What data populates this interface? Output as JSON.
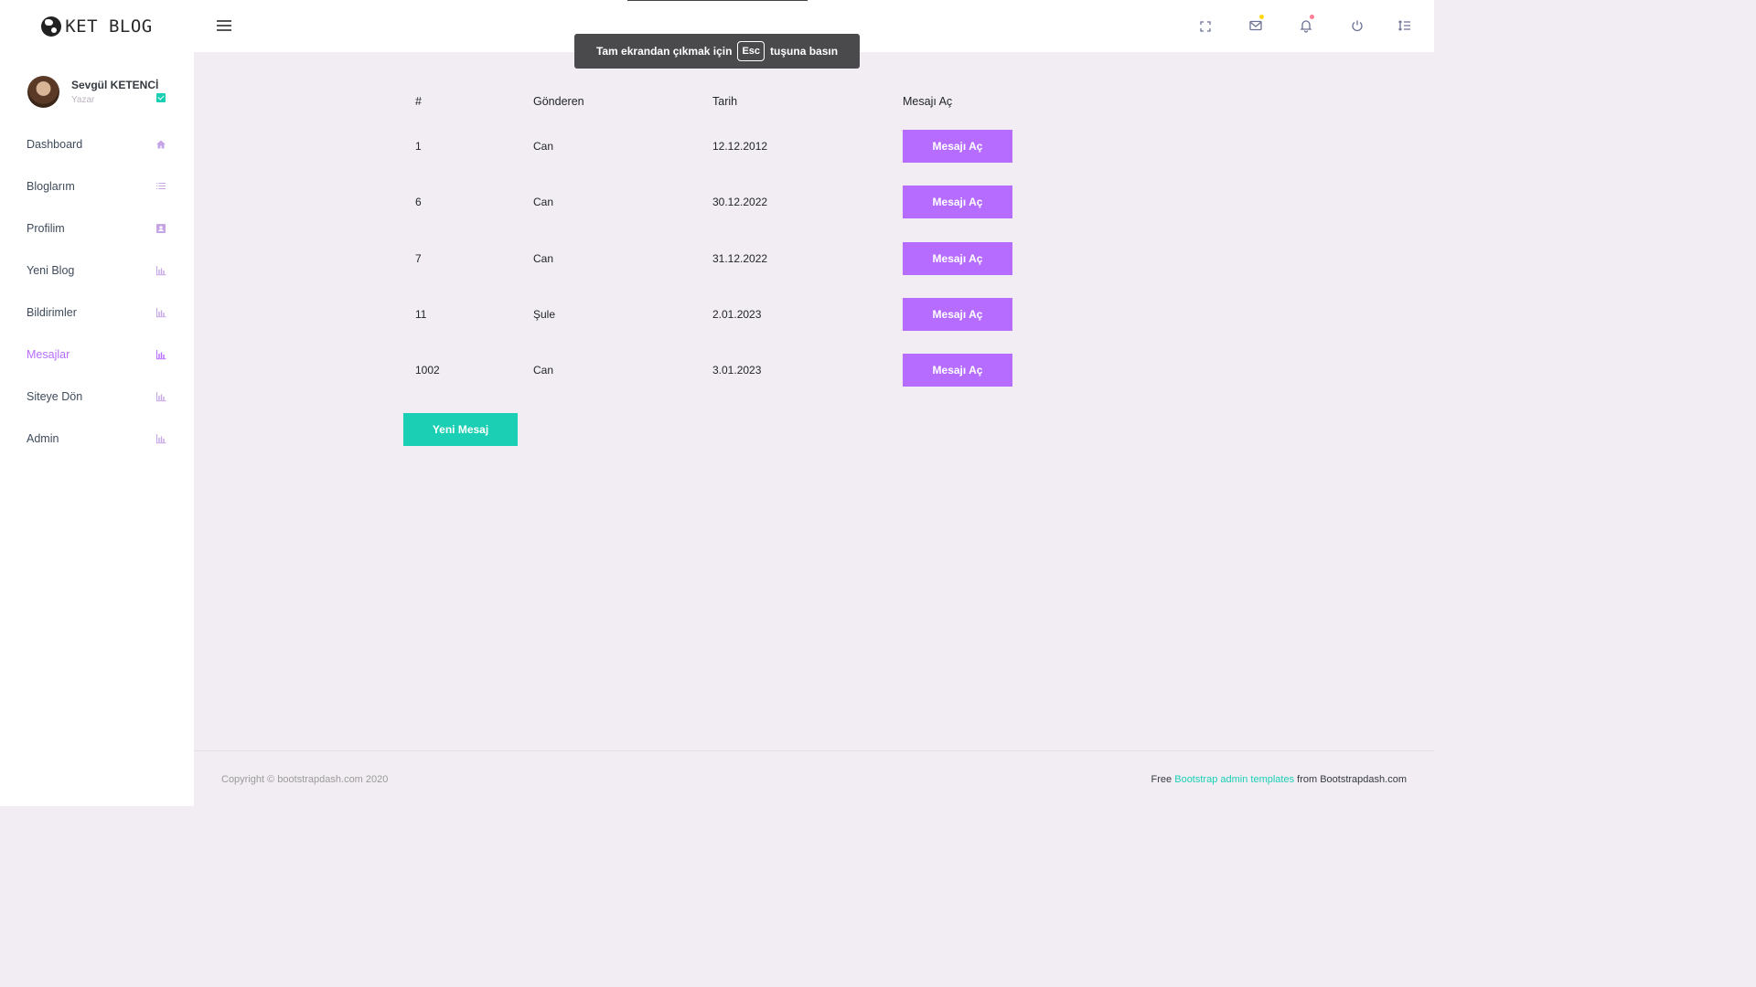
{
  "brand": {
    "name": "KET BLOG"
  },
  "profile": {
    "name": "Sevgül KETENCİ",
    "role": "Yazar"
  },
  "sidebar": {
    "items": [
      {
        "label": "Dashboard",
        "icon": "home-icon",
        "active": false
      },
      {
        "label": "Bloglarım",
        "icon": "list-icon",
        "active": false
      },
      {
        "label": "Profilim",
        "icon": "contacts-icon",
        "active": false
      },
      {
        "label": "Yeni Blog",
        "icon": "chart-icon",
        "active": false
      },
      {
        "label": "Bildirimler",
        "icon": "chart-icon",
        "active": false
      },
      {
        "label": "Mesajlar",
        "icon": "chart-icon",
        "active": true
      },
      {
        "label": "Siteye Dön",
        "icon": "chart-icon",
        "active": false
      },
      {
        "label": "Admin",
        "icon": "chart-icon",
        "active": false
      }
    ]
  },
  "fullscreen_toast": {
    "before": "Tam ekrandan çıkmak için",
    "key": "Esc",
    "after": "tuşuna basın"
  },
  "table": {
    "headers": [
      "#",
      "Gönderen",
      "Tarih",
      "Mesajı Aç"
    ],
    "rows": [
      {
        "id": "1",
        "sender": "Can",
        "date": "12.12.2012",
        "action": "Mesajı Aç"
      },
      {
        "id": "6",
        "sender": "Can",
        "date": "30.12.2022",
        "action": "Mesajı Aç"
      },
      {
        "id": "7",
        "sender": "Can",
        "date": "31.12.2022",
        "action": "Mesajı Aç"
      },
      {
        "id": "11",
        "sender": "Şule",
        "date": "2.01.2023",
        "action": "Mesajı Aç"
      },
      {
        "id": "1002",
        "sender": "Can",
        "date": "3.01.2023",
        "action": "Mesajı Aç"
      }
    ]
  },
  "new_message_button": "Yeni Mesaj",
  "footer": {
    "copyright": "Copyright © bootstrapdash.com 2020",
    "free_prefix": "Free",
    "link_text": "Bootstrap admin templates",
    "suffix": "from Bootstrapdash.com"
  },
  "colors": {
    "accent": "#b66dff",
    "success": "#1bcfb4",
    "background": "#f2edf3"
  }
}
